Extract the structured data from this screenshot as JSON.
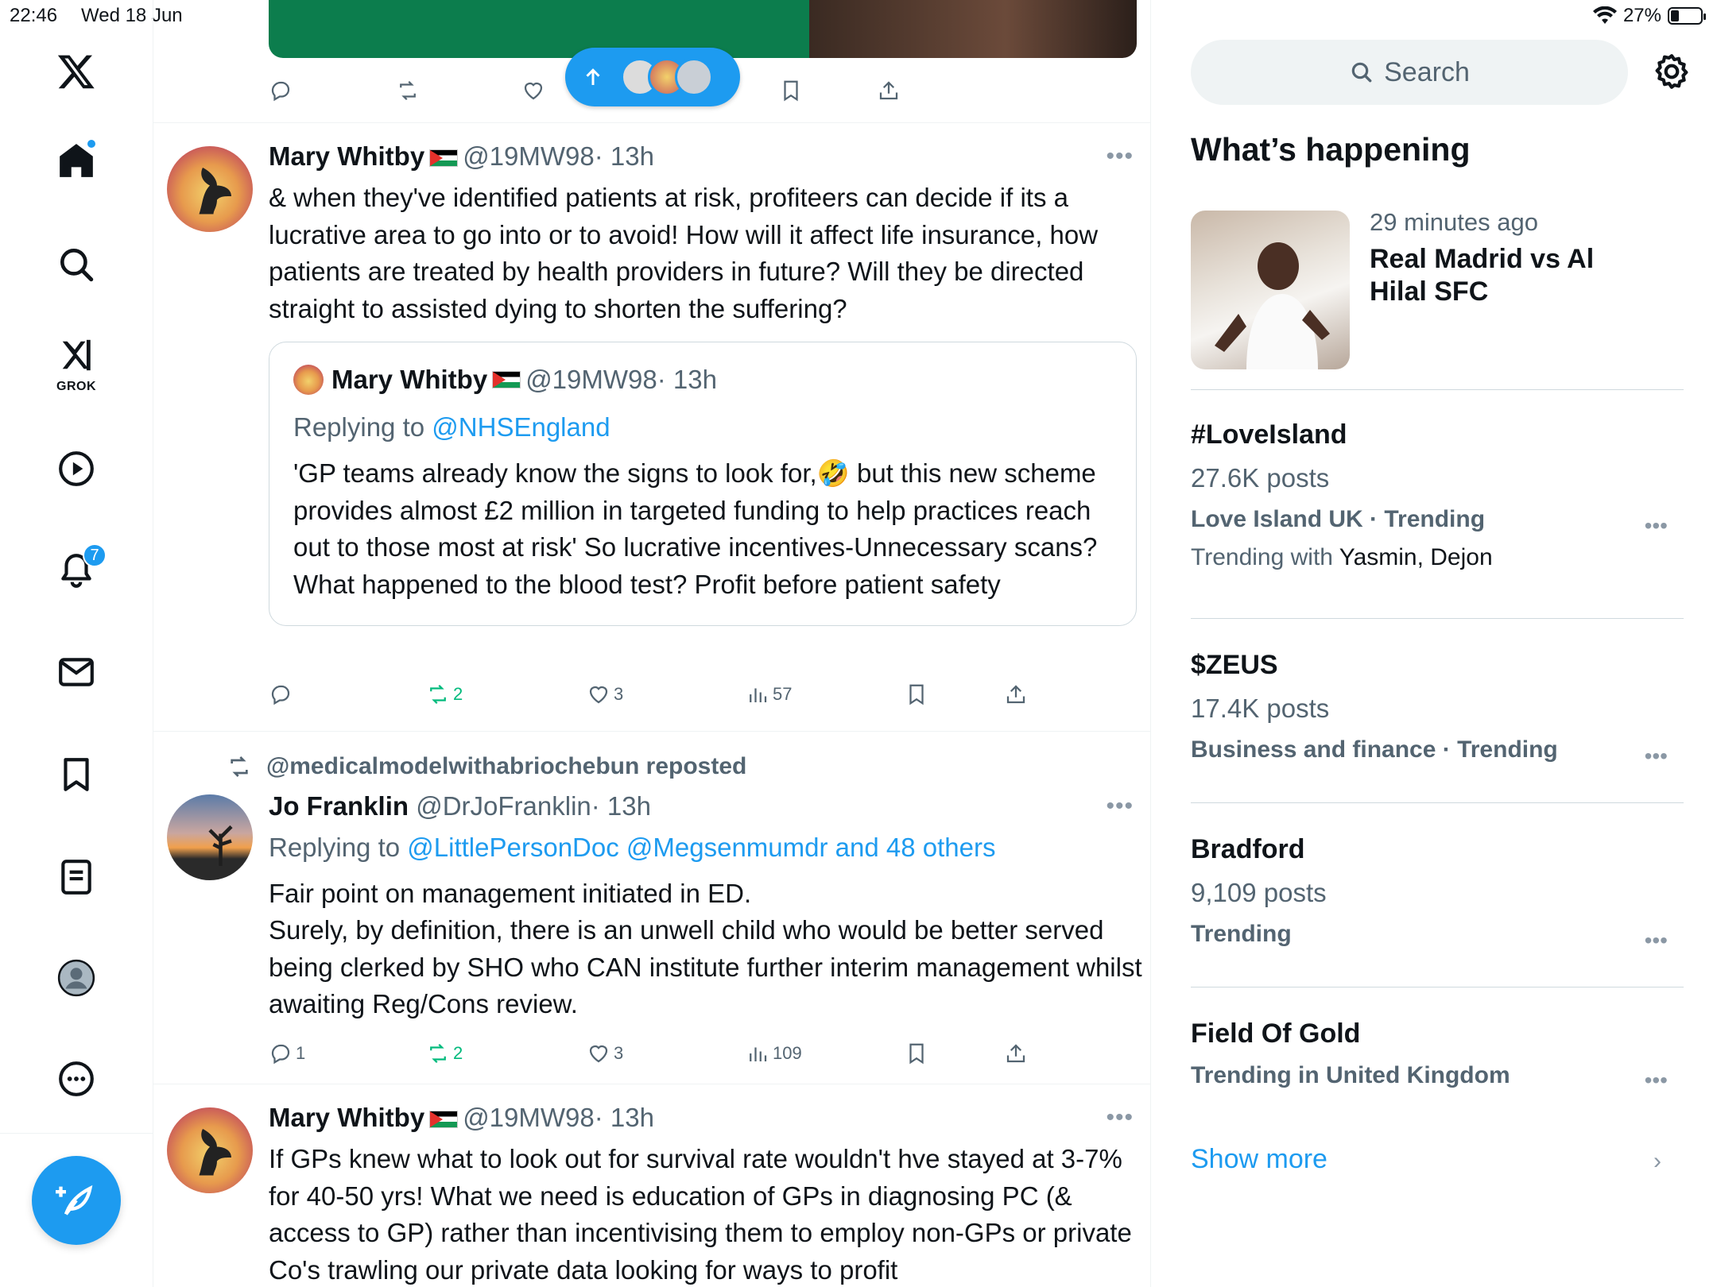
{
  "status": {
    "time": "22:46",
    "date": "Wed 18 Jun",
    "battery": "27%"
  },
  "nav": {
    "items": [
      "home",
      "explore",
      "grok",
      "video",
      "notifications",
      "messages",
      "bookmarks",
      "lists",
      "profile",
      "more"
    ],
    "grok_label": "GROK",
    "notifications_count": "7"
  },
  "feed": {
    "top_actions": {
      "reply": "",
      "repost": "",
      "like": ""
    },
    "posts": [
      {
        "name": "Mary Whitby",
        "handle": "@19MW98",
        "time": "· 13h",
        "text": "& when they've identified patients at risk, profiteers can decide if its a lucrative area to go into or to avoid! How will it affect life insurance, how patients are treated by health providers in future? Will they be directed straight to assisted dying to shorten the suffering?",
        "quote": {
          "name": "Mary Whitby",
          "handle": "@19MW98",
          "time": "· 13h",
          "replying_label": "Replying to",
          "replying_to": "@NHSEngland",
          "text_a": "'GP teams already know the signs to look for,",
          "emoji": "🤣",
          "text_b": " but this new scheme provides almost £2 million in targeted funding to help practices reach out to those most at risk' So lucrative incentives-Unnecessary scans? What happened to the blood test? Profit before patient safety"
        },
        "stats": {
          "replies": "",
          "reposts": "2",
          "likes": "3",
          "views": "57"
        }
      },
      {
        "reposted_by": "@medicalmodelwithabriochebun reposted",
        "name": "Jo Franklin",
        "handle": "@DrJoFranklin",
        "time": "· 13h",
        "replying_label": "Replying to",
        "replying_to": "@LittlePersonDoc @Megsenmumdr and 48 others",
        "text_1": "Fair point on management initiated in ED.",
        "text_2": "Surely, by definition, there is an unwell child who would be better served being clerked by SHO who CAN institute further interim management whilst awaiting Reg/Cons review.",
        "stats": {
          "replies": "1",
          "reposts": "2",
          "likes": "3",
          "views": "109"
        }
      },
      {
        "name": "Mary Whitby",
        "handle": "@19MW98",
        "time": "· 13h",
        "text": "If GPs knew what to look out for survival rate wouldn't hve stayed at 3-7% for 40-50 yrs! What we need is education of GPs in diagnosing PC (& access to GP) rather than incentivising them to employ non-GPs or private Co's trawling our private data looking for ways to profit"
      }
    ]
  },
  "sidebar": {
    "search_placeholder": "Search",
    "heading": "What’s happening",
    "news": {
      "meta": "29 minutes ago",
      "title": "Real Madrid vs Al Hilal SFC"
    },
    "trends": [
      {
        "title": "#LoveIsland",
        "posts": "27.6K posts",
        "category": "Love Island UK · Trending",
        "with_label": "Trending with",
        "with_names": "Yasmin, Dejon"
      },
      {
        "title": "$ZEUS",
        "posts": "17.4K posts",
        "category": "Business and finance · Trending"
      },
      {
        "title": "Bradford",
        "posts": "9,109 posts",
        "category": "Trending"
      },
      {
        "title": "Field Of Gold",
        "category": "Trending in United Kingdom"
      }
    ],
    "show_more": "Show more"
  },
  "colors": {
    "accent": "#1d9bf0",
    "repost_green": "#00ba7c",
    "muted": "#536471"
  }
}
